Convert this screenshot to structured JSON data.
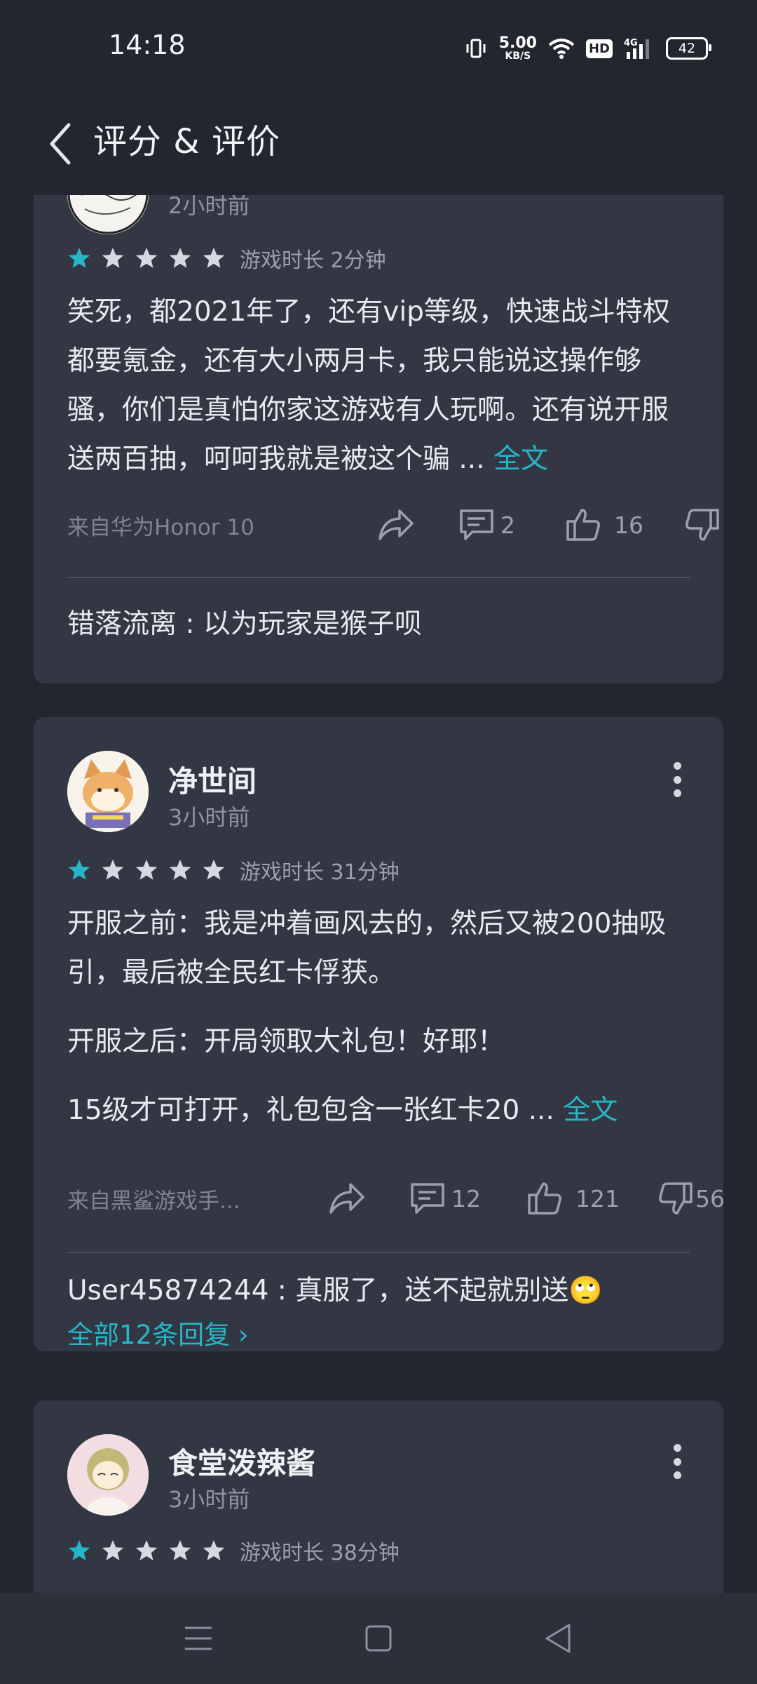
{
  "status_bar": {
    "time": "14:18",
    "net_speed_value": "5.00",
    "net_speed_unit": "KB/S",
    "hd_label": "HD",
    "network_type": "4G",
    "battery_level": "42",
    "icons": [
      "vibrate-icon",
      "wifi-icon",
      "signal-icon",
      "battery-icon"
    ]
  },
  "header": {
    "title": "评分 & 评价",
    "back_icon": "chevron-left-icon"
  },
  "reviews": [
    {
      "time_ago": "2小时前",
      "rating": 1,
      "playtime": "游戏时长 2分钟",
      "text": "笑死，都2021年了，还有vip等级，快速战斗特权都要氪金，还有大小两月卡，我只能说这操作够骚，你们是真怕你家这游戏有人玩啊。还有说开服送两百抽，呵呵我就是被这个骗 ...",
      "full_text_link": "全文",
      "source": "来自华为Honor 10",
      "comments": "2",
      "likes": "16",
      "dislikes": "",
      "reply": "错落流离 : 以为玩家是猴子呗"
    },
    {
      "username": "净世间",
      "time_ago": "3小时前",
      "rating": 1,
      "playtime": "游戏时长 31分钟",
      "paragraph1": "开服之前：我是冲着画风去的，然后又被200抽吸引，最后被全民红卡俘获。",
      "paragraph2": "开服之后：开局领取大礼包！好耶！",
      "paragraph3": "15级才可打开，礼包包含一张红卡20 ...",
      "full_text_link": "全文",
      "source": "来自黑鲨游戏手...",
      "comments": "12",
      "likes": "121",
      "dislikes": "56",
      "reply": "User45874244 : 真服了，送不起就别送🙄",
      "all_replies": "全部12条回复 ›"
    },
    {
      "username": "食堂泼辣酱",
      "time_ago": "3小时前",
      "rating": 1,
      "playtime": "游戏时长 38分钟"
    }
  ],
  "colors": {
    "background": "#23262f",
    "card": "#333744",
    "accent": "#27b6c8",
    "star_empty": "#d6d9e0"
  },
  "nav_bar": {
    "icons": [
      "menu-icon",
      "home-icon",
      "back-triangle-icon"
    ]
  }
}
